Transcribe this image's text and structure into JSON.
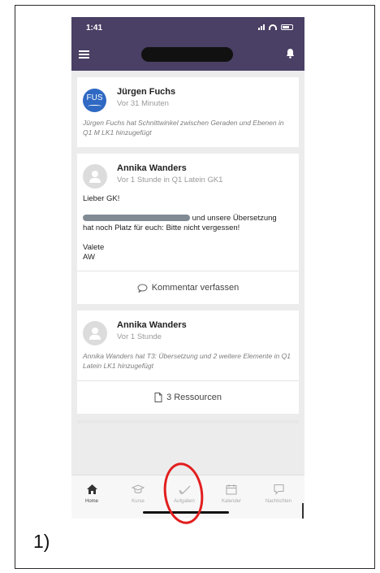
{
  "status_bar": {
    "time": "1:41"
  },
  "feed": {
    "posts": [
      {
        "author": "Jürgen Fuchs",
        "avatar_text": "FUS",
        "meta": "Vor 31 Minuten",
        "note": "Jürgen Fuchs hat Schnittwinkel zwischen Geraden und Ebenen in Q1 M LK1 hinzugefügt"
      },
      {
        "author": "Annika Wanders",
        "meta": "Vor 1 Stunde in Q1 Latein GK1",
        "greeting": "Lieber GK!",
        "line1_suffix": "und unsere Übersetzung",
        "line2": "hat noch Platz für euch: Bitte nicht vergessen!",
        "closing1": "Valete",
        "closing2": "AW",
        "action_label": "Kommentar verfassen",
        "action_icon": "speech-bubble-icon"
      },
      {
        "author": "Annika Wanders",
        "meta": "Vor 1 Stunde",
        "note": "Annika Wanders hat T3: Übersetzung und 2 weitere Elemente in Q1 Latein LK1 hinzugefügt",
        "action_label": "3 Ressourcen",
        "action_icon": "document-icon"
      }
    ]
  },
  "tabs": [
    {
      "label": "Home",
      "icon": "home-icon",
      "active": true
    },
    {
      "label": "Kurse",
      "icon": "graduation-cap-icon",
      "active": false
    },
    {
      "label": "Aufgaben",
      "icon": "checkmark-icon",
      "active": false
    },
    {
      "label": "Kalender",
      "icon": "calendar-icon",
      "active": false
    },
    {
      "label": "Nachrichten",
      "icon": "chat-icon",
      "active": false
    }
  ],
  "caption": "1)",
  "colors": {
    "header": "#4a3f64",
    "annotation": "#e21e1e",
    "fus_avatar": "#2f69c3"
  }
}
